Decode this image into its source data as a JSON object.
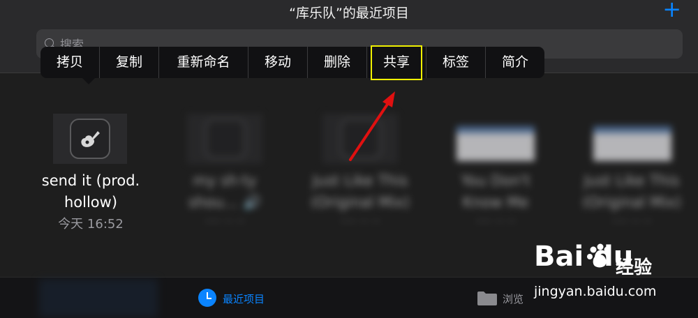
{
  "header": {
    "title": "“库乐队”的最近项目",
    "add_label": "+"
  },
  "search": {
    "placeholder": "搜索"
  },
  "context_menu": {
    "items": [
      {
        "label": "拷贝"
      },
      {
        "label": "复制"
      },
      {
        "label": "重新命名"
      },
      {
        "label": "移动"
      },
      {
        "label": "删除"
      },
      {
        "label": "共享",
        "highlighted": true
      },
      {
        "label": "标签"
      },
      {
        "label": "简介"
      }
    ]
  },
  "files": [
    {
      "name_line1": "send it (prod.",
      "name_line2": "hollow)",
      "date": "今天 16:52",
      "icon": "garageband-icon"
    },
    {
      "name_line1": "my sh·ty",
      "name_line2": "shou… 🔊",
      "date": "···· ·· ··",
      "icon": "garageband-icon",
      "blurred": true
    },
    {
      "name_line1": "Just Like This",
      "name_line2": "(Original Mix)",
      "date": "···· ·· ··",
      "icon": "garageband-icon",
      "blurred": true
    },
    {
      "name_line1": "You Don't",
      "name_line2": "Know Me",
      "date": "···· ·· ··",
      "icon": "document-icon",
      "blurred": true
    },
    {
      "name_line1": "Just Like This",
      "name_line2": "(Original Mix)",
      "date": "···· ·· ··",
      "icon": "document-icon",
      "blurred": true
    }
  ],
  "tabbar": {
    "recent_label": "最近项目",
    "browse_label": "浏览"
  },
  "watermark": {
    "logo": "Bai  du",
    "text": "经验",
    "url": "jingyan.baidu.com"
  },
  "colors": {
    "accent": "#0a84ff",
    "highlight_box": "#f0f000",
    "arrow": "#e01010"
  }
}
